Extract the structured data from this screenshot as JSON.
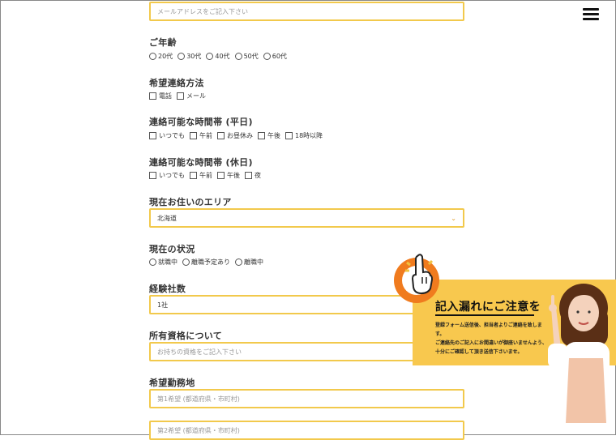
{
  "email": {
    "placeholder": "メールアドレスをご記入下さい"
  },
  "age": {
    "label": "ご年齢",
    "options": [
      "20代",
      "30代",
      "40代",
      "50代",
      "60代"
    ]
  },
  "contact_method": {
    "label": "希望連絡方法",
    "options": [
      "電話",
      "メール"
    ]
  },
  "weekday_time": {
    "label": "連絡可能な時間帯 (平日)",
    "options": [
      "いつでも",
      "午前",
      "お昼休み",
      "午後",
      "18時以降"
    ]
  },
  "holiday_time": {
    "label": "連絡可能な時間帯 (休日)",
    "options": [
      "いつでも",
      "午前",
      "午後",
      "夜"
    ]
  },
  "area": {
    "label": "現在お住いのエリア",
    "value": "北海道"
  },
  "status": {
    "label": "現在の状況",
    "options": [
      "就職中",
      "離職予定あり",
      "離職中"
    ]
  },
  "companies": {
    "label": "経験社数",
    "value": "1社"
  },
  "qualifications": {
    "label": "所有資格について",
    "placeholder": "お持ちの資格をご記入下さい"
  },
  "workplace": {
    "label": "希望勤務地",
    "placeholder1": "第1希望 (都道府県・市町村)",
    "placeholder2": "第2希望 (都道府県・市町村)"
  },
  "banner": {
    "title": "記入漏れにご注意を",
    "line1": "登録フォーム送信後、担当者よりご連絡を致します。",
    "line2": "ご連絡先のご記入にお間違いが御座いませんよう、",
    "line3": "十分にご確認して頂き送信下さいませ。"
  },
  "colors": {
    "accent": "#f2c94c",
    "banner": "#f8c84e",
    "badge": "#f07b1e"
  },
  "icons": {
    "menu": "hamburger-icon",
    "select": "chevron-down-icon",
    "pointer": "pointing-hand-icon"
  }
}
